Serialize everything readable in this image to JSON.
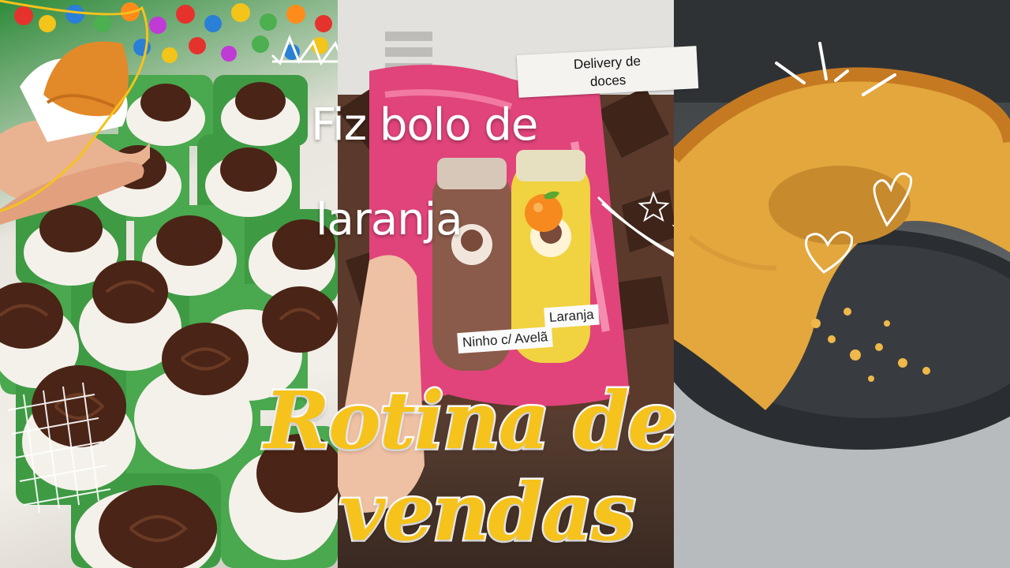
{
  "headline": {
    "line1": "Fiz bolo de",
    "line2": "laranja"
  },
  "tag": {
    "line1": "Delivery de",
    "line2": "doces"
  },
  "title": {
    "line1": "Rotina de",
    "line2": "vendas"
  },
  "package_labels": {
    "left": "Ninho c/ Avelã",
    "right": "Laranja"
  },
  "colors": {
    "title_fill": "#f6c21c",
    "title_stroke": "#ffffff",
    "headline": "#ffffff",
    "wrapper_pink": "#e0447a",
    "cake": "#e3a73d"
  },
  "icons": [
    "crown-doodle",
    "orange-emoji",
    "arrow-doodle",
    "heart-doodle",
    "star-doodle",
    "sparkle-lines-doodle",
    "grid-doodle"
  ]
}
